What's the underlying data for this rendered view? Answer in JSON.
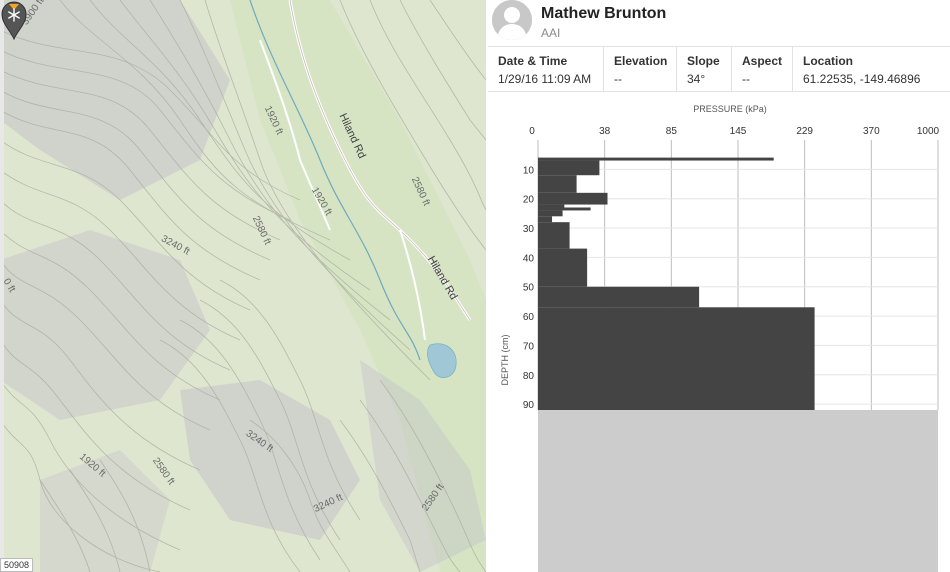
{
  "map": {
    "contour_labels": [
      {
        "id": "lbl-3900",
        "text": "3900 ft"
      },
      {
        "id": "lbl-1920-a",
        "text": "1920 ft"
      },
      {
        "id": "lbl-1920-b",
        "text": "1920 ft"
      },
      {
        "id": "lbl-2580-a",
        "text": "2580 ft"
      },
      {
        "id": "lbl-2580-b",
        "text": "2580 ft"
      },
      {
        "id": "lbl-3240-a",
        "text": "3240 ft"
      },
      {
        "id": "lbl-3240-b",
        "text": "3240 ft"
      },
      {
        "id": "lbl-3240-c",
        "text": "3240 ft"
      },
      {
        "id": "lbl-1920-c",
        "text": "1920 ft"
      },
      {
        "id": "lbl-2580-c",
        "text": "2580 ft"
      },
      {
        "id": "lbl-2580-d",
        "text": "2580 ft"
      },
      {
        "id": "lbl-0ft",
        "text": "0 ft"
      }
    ],
    "road_labels": [
      "Hiland Rd",
      "Hiland Rd"
    ],
    "scale_text": "50908",
    "marker_icon": "snowflake-marker-icon",
    "colors": {
      "terrain": "#dfe6d0",
      "shade": "#bcbcc2",
      "water": "#9fc7d6",
      "road": "#ffffff"
    }
  },
  "user": {
    "name": "Mathew Brunton",
    "organization": "AAI",
    "avatar_icon": "user-avatar-icon"
  },
  "observation": {
    "date_time_label": "Date & Time",
    "date_time": "1/29/16 11:09 AM",
    "elevation_label": "Elevation",
    "elevation": "--",
    "slope_label": "Slope",
    "slope": "34°",
    "aspect_label": "Aspect",
    "aspect": "--",
    "location_label": "Location",
    "location": "61.22535, -149.46896"
  },
  "chart_data": {
    "type": "bar",
    "orientation": "horizontal-profile",
    "title": "PRESSURE (kPa)",
    "xlabel": "PRESSURE (kPa)",
    "ylabel": "DEPTH (cm)",
    "x_ticks": [
      "0",
      "38",
      "85",
      "145",
      "229",
      "370",
      "1000"
    ],
    "y_ticks": [
      "10",
      "20",
      "30",
      "40",
      "50",
      "60",
      "70",
      "80",
      "90"
    ],
    "ylim": [
      0,
      92
    ],
    "grid": true,
    "colors": {
      "bars": "#444444",
      "below_profile": "#cccccc"
    },
    "layers": [
      {
        "top": 6,
        "bottom": 7,
        "pressure": 190
      },
      {
        "top": 7,
        "bottom": 12,
        "pressure": 35
      },
      {
        "top": 12,
        "bottom": 18,
        "pressure": 22
      },
      {
        "top": 18,
        "bottom": 22,
        "pressure": 40
      },
      {
        "top": 22,
        "bottom": 23,
        "pressure": 15
      },
      {
        "top": 23,
        "bottom": 24,
        "pressure": 30
      },
      {
        "top": 24,
        "bottom": 26,
        "pressure": 14
      },
      {
        "top": 26,
        "bottom": 28,
        "pressure": 8
      },
      {
        "top": 28,
        "bottom": 37,
        "pressure": 18
      },
      {
        "top": 37,
        "bottom": 50,
        "pressure": 28
      },
      {
        "top": 50,
        "bottom": 57,
        "pressure": 110
      },
      {
        "top": 57,
        "bottom": 92,
        "pressure": 250
      }
    ]
  }
}
